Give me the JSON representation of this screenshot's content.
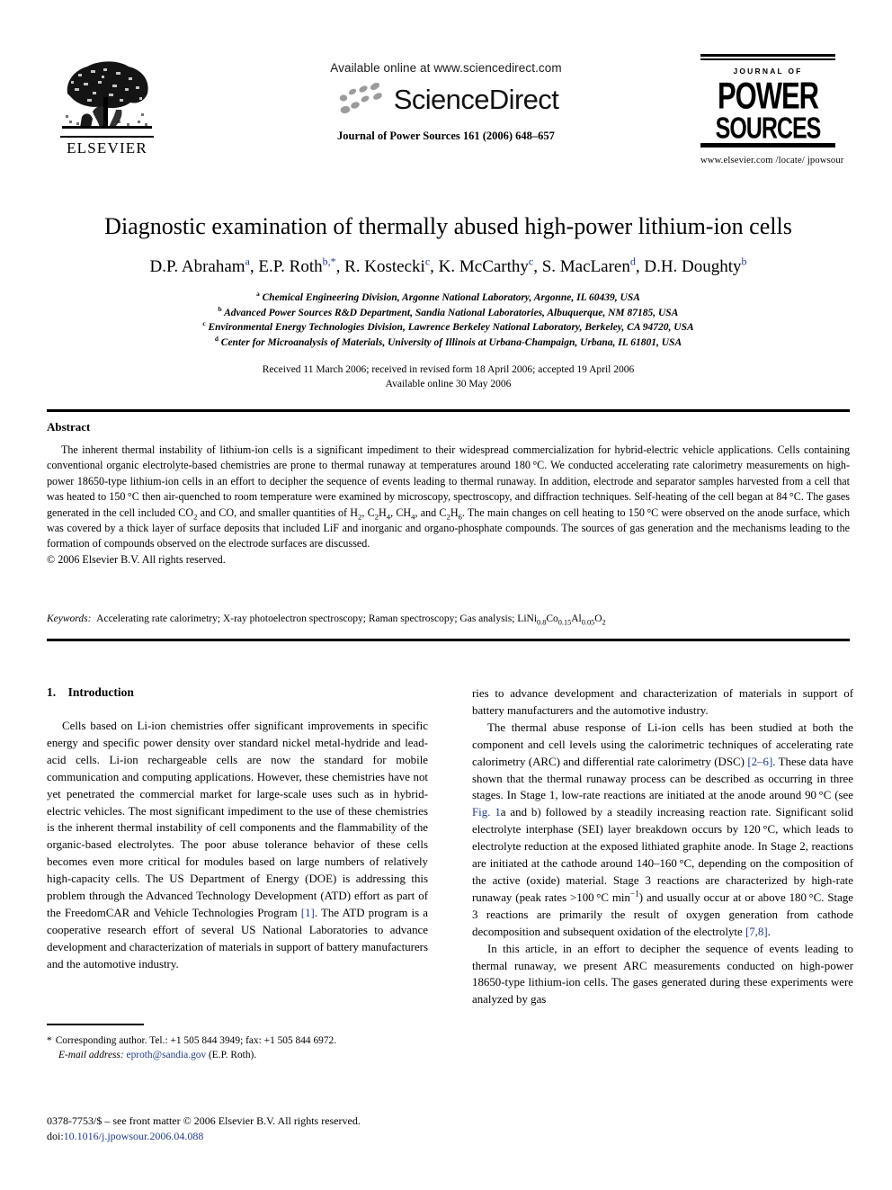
{
  "header": {
    "publisher_name": "ELSEVIER",
    "available_online": "Available online at www.sciencedirect.com",
    "sciencedirect_wordmark": "ScienceDirect",
    "journal_citation": "Journal of Power Sources 161 (2006) 648–657",
    "journal_logo_line1": "JOURNAL OF",
    "journal_logo_line2": "POWER",
    "journal_logo_line3": "SOURCES",
    "journal_url": "www.elsevier.com /locate/ jpowsour"
  },
  "title": "Diagnostic examination of thermally abused high-power lithium-ion cells",
  "authors": [
    {
      "name": "D.P. Abraham",
      "marks": "a"
    },
    {
      "name": "E.P. Roth",
      "marks": "b,*"
    },
    {
      "name": "R. Kostecki",
      "marks": "c"
    },
    {
      "name": "K. McCarthy",
      "marks": "c"
    },
    {
      "name": "S. MacLaren",
      "marks": "d"
    },
    {
      "name": "D.H. Doughty",
      "marks": "b"
    }
  ],
  "affiliations": [
    {
      "mark": "a",
      "text": "Chemical Engineering Division, Argonne National Laboratory, Argonne, IL 60439, USA"
    },
    {
      "mark": "b",
      "text": "Advanced Power Sources R&D Department, Sandia National Laboratories, Albuquerque, NM 87185, USA"
    },
    {
      "mark": "c",
      "text": "Environmental Energy Technologies Division, Lawrence Berkeley National Laboratory, Berkeley, CA 94720, USA"
    },
    {
      "mark": "d",
      "text": "Center for Microanalysis of Materials, University of Illinois at Urbana-Champaign, Urbana, IL 61801, USA"
    }
  ],
  "dates": {
    "received": "Received 11 March 2006; received in revised form 18 April 2006; accepted 19 April 2006",
    "available_online": "Available online 30 May 2006"
  },
  "abstract": {
    "heading": "Abstract",
    "paragraph_part1": "The inherent thermal instability of lithium-ion cells is a significant impediment to their widespread commercialization for hybrid-electric vehicle applications. Cells containing conventional organic electrolyte-based chemistries are prone to thermal runaway at temperatures around 180 °C. We conducted accelerating rate calorimetry measurements on high-power 18650-type lithium-ion cells in an effort to decipher the sequence of events leading to thermal runaway. In addition, electrode and separator samples harvested from a cell that was heated to 150 °C then air-quenched to room temperature were examined by microscopy, spectroscopy, and diffraction techniques. Self-heating of the cell began at 84 °C. The gases generated in the cell included CO",
    "sub1": "2",
    "paragraph_part2": " and CO, and smaller quantities of H",
    "sub2": "2",
    "paragraph_part3": ", C",
    "sub3": "2",
    "paragraph_part4": "H",
    "sub4": "4",
    "paragraph_part5": ", CH",
    "sub5": "4",
    "paragraph_part6": ", and C",
    "sub6": "2",
    "paragraph_part7": "H",
    "sub7": "6",
    "paragraph_part8": ". The main changes on cell heating to 150 °C were observed on the anode surface, which was covered by a thick layer of surface deposits that included LiF and inorganic and organo-phosphate compounds. The sources of gas generation and the mechanisms leading to the formation of compounds observed on the electrode surfaces are discussed.",
    "copyright": "© 2006 Elsevier B.V. All rights reserved."
  },
  "keywords": {
    "label": "Keywords:",
    "list_plain": "Accelerating rate calorimetry; X-ray photoelectron spectroscopy; Raman spectroscopy; Gas analysis; LiNi",
    "sub_ni": "0.8",
    "mid_co": "Co",
    "sub_co": "0.15",
    "mid_al": "Al",
    "sub_al": "0.05",
    "mid_o": "O",
    "sub_o": "2"
  },
  "section": {
    "number_title": "1. Introduction"
  },
  "body": {
    "left_p1_a": "Cells based on Li-ion chemistries offer significant improvements in specific energy and specific power density over standard nickel metal-hydride and lead-acid cells. Li-ion rechargeable cells are now the standard for mobile communication and computing applications. However, these chemistries have not yet penetrated the commercial market for large-scale uses such as in hybrid-electric vehicles. The most significant impediment to the use of these chemistries is the inherent thermal instability of cell components and the flammability of the organic-based electrolytes. The poor abuse tolerance behavior of these cells becomes even more critical for modules based on large numbers of relatively high-capacity cells. The US Department of Energy (DOE) is addressing this problem through the Advanced Technology Development (ATD) effort as part of the FreedomCAR and Vehicle Technologies Program ",
    "ref1": "[1]",
    "left_p1_b": ". The ATD program is a cooperative research effort of several US National Laboratories to advance development and characterization of materials in support of battery manufacturers and the automotive industry.",
    "right_p1_carry": "ries to advance development and characterization of materials in support of battery manufacturers and the automotive industry.",
    "right_p2_a": "The thermal abuse response of Li-ion cells has been studied at both the component and cell levels using the calorimetric techniques of accelerating rate calorimetry (ARC) and differential rate calorimetry (DSC) ",
    "ref2": "[2–6]",
    "right_p2_b": ". These data have shown that the thermal runaway process can be described as occurring in three stages. In Stage 1, low-rate reactions are initiated at the anode around 90 °C (see ",
    "reffig": "Fig. 1",
    "right_p2_c": "a and b) followed by a steadily increasing reaction rate. Significant solid electrolyte interphase (SEI) layer breakdown occurs by 120 °C, which leads to electrolyte reduction at the exposed lithiated graphite anode. In Stage 2, reactions are initiated at the cathode around 140–160 °C, depending on the composition of the active (oxide) material. Stage 3 reactions are characterized by high-rate runaway (peak rates >100 °C min",
    "sup_minus1": "−1",
    "right_p2_d": ") and usually occur at or above 180 °C. Stage 3 reactions are primarily the result of oxygen generation from cathode decomposition and subsequent oxidation of the electrolyte ",
    "ref78": "[7,8]",
    "right_p2_e": ".",
    "right_p3": "In this article, in an effort to decipher the sequence of events leading to thermal runaway, we present ARC measurements conducted on high-power 18650-type lithium-ion cells. The gases generated during these experiments were analyzed by gas"
  },
  "footnotes": {
    "star": "*",
    "corresponding": "Corresponding author. Tel.: +1 505 844 3949; fax: +1 505 844 6972.",
    "email_label": "E-mail address:",
    "email": "eproth@sandia.gov",
    "email_suffix": "(E.P. Roth).",
    "issn_line": "0378-7753/$ – see front matter © 2006 Elsevier B.V. All rights reserved.",
    "doi_label": "doi:",
    "doi_value": "10.1016/j.jpowsour.2006.04.088"
  },
  "colors": {
    "link": "#1f3d8c",
    "text": "#000000",
    "page_background": "#ffffff"
  }
}
